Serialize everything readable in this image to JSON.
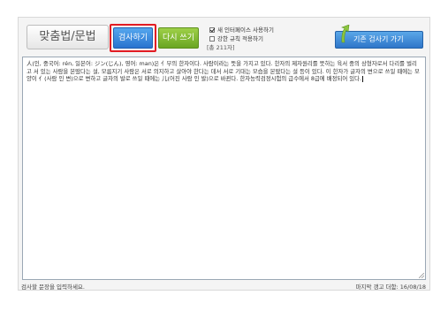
{
  "toolbar": {
    "mode_tab": "맞춤법/문법",
    "check_button": "검사하기",
    "rewrite_button": "다시 쓰기",
    "options": [
      {
        "label": "새 인터페이스 사용하기",
        "checked": true
      },
      {
        "label": "강한 규칙 적용하기",
        "checked": false
      }
    ],
    "char_count": "[총 211자]",
    "legacy_button": "기존 검사기 가기"
  },
  "editor": {
    "text": "人(인, 중국어: rén, 일본어: ジン(じん), 영어: man)은 亻부의 한자이다. 사람이라는 뜻을 가지고 있다. 한자의 제자원리를 뜻하는 육서 중의 상형자로서 다리를 벌리고 서 있는 사람을 본땄다는 설, 모름지기 사람은 서로 의지하고 살아야 한다는 데서 서로 기대는 모습을 본땄다는 설 등이 있다. 이 한자가 글자의 변으로 쓰일 때에는 모양이 亻(사람 인 변)으로 변하고 글자의 발로 쓰일 때에는 儿(어진 사람 인 발)으로 바뀐다. 한자능력검정시험의 급수에서 8급에 배정되어 있다."
  },
  "status": {
    "hint": "검사할 문장을 입력하세요.",
    "last_update": "마지막 갱고 더함: 16/08/18"
  },
  "colors": {
    "highlight_border": "#e21c23",
    "check_button": "#3b8ae0",
    "rewrite_button": "#86bf34",
    "legacy_button": "#3f85d6"
  }
}
